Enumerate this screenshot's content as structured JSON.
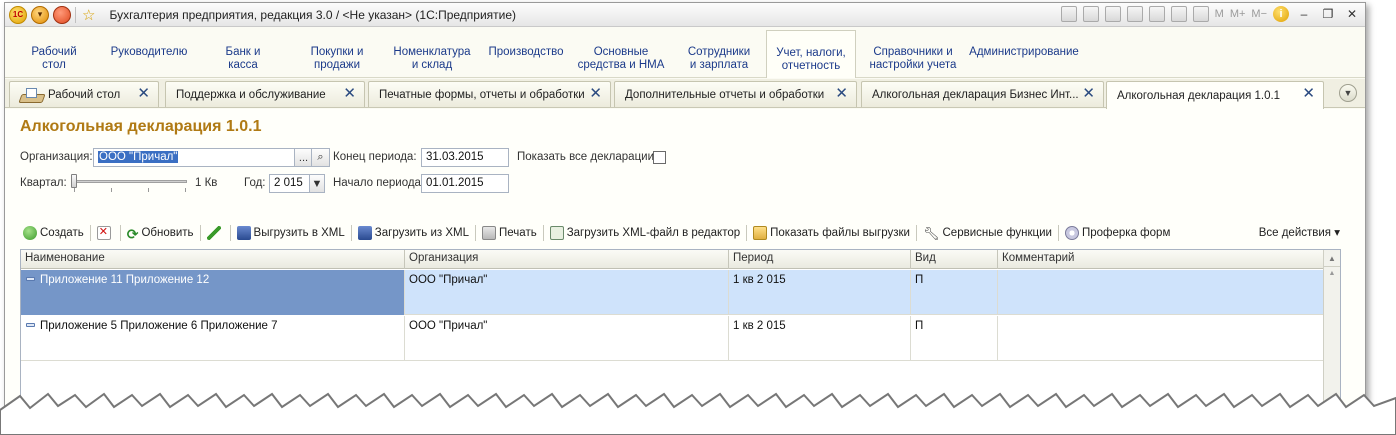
{
  "titlebar": {
    "title": "Бухгалтерия предприятия, редакция 3.0 / <Не указан>  (1С:Предприятие)",
    "logo": "1С",
    "m_labels": [
      "M",
      "M+",
      "M−"
    ]
  },
  "sections": [
    {
      "label": "Рабочий\nстол"
    },
    {
      "label": "Руководителю"
    },
    {
      "label": "Банк и\nкасса"
    },
    {
      "label": "Покупки и\nпродажи"
    },
    {
      "label": "Номенклатура\nи склад"
    },
    {
      "label": "Производство"
    },
    {
      "label": "Основные\nсредства и НМА"
    },
    {
      "label": "Сотрудники\nи зарплата"
    },
    {
      "label": "Учет, налоги,\nотчетность"
    },
    {
      "label": "Справочники и\nнастройки учета"
    },
    {
      "label": "Администрирование"
    }
  ],
  "tabs": [
    {
      "label": "Рабочий стол"
    },
    {
      "label": "Поддержка и обслуживание"
    },
    {
      "label": "Печатные формы, отчеты и обработки"
    },
    {
      "label": "Дополнительные отчеты и обработки"
    },
    {
      "label": "Алкогольная декларация Бизнес Инт..."
    },
    {
      "label": "Алкогольная декларация 1.0.1"
    }
  ],
  "form": {
    "title": "Алкогольная декларация 1.0.1",
    "org_label": "Организация:",
    "org_value": "ООО \"Причал\"",
    "org_select_btn": "...",
    "period_end_label": "Конец периода:",
    "period_end_value": "31.03.2015",
    "show_all_label": "Показать все декларации:",
    "quarter_label": "Квартал:",
    "quarter_value": "1 Кв",
    "quarter_level": 0,
    "year_label": "Год:",
    "year_value": "2 015",
    "period_start_label": "Начало периода:",
    "period_start_value": "01.01.2015"
  },
  "toolbar": {
    "create": "Создать",
    "refresh": "Обновить",
    "export_xml": "Выгрузить в XML",
    "import_xml": "Загрузить из XML",
    "print": "Печать",
    "load_editor": "Загрузить XML-файл в редактор",
    "show_files": "Показать файлы выгрузки",
    "service": "Сервисные функции",
    "check_forms": "Проферка форм",
    "all_actions": "Все действия ▾"
  },
  "table": {
    "columns": [
      "Наименование",
      "Организация",
      "Период",
      "Вид",
      "Комментарий"
    ],
    "rows": [
      {
        "name": "Приложение 11 Приложение 12",
        "org": "ООО \"Причал\"",
        "period": "1 кв 2 015",
        "kind": "П",
        "comment": ""
      },
      {
        "name": "Приложение 5 Приложение 6 Приложение 7",
        "org": "ООО \"Причал\"",
        "period": "1 кв 2 015",
        "kind": "П",
        "comment": ""
      }
    ]
  },
  "colors": {
    "title_accent": "#b07a14",
    "selected_row": "#cfe3fb",
    "selected_cell": "#7596c8",
    "link_blue": "#1b3a8a"
  }
}
